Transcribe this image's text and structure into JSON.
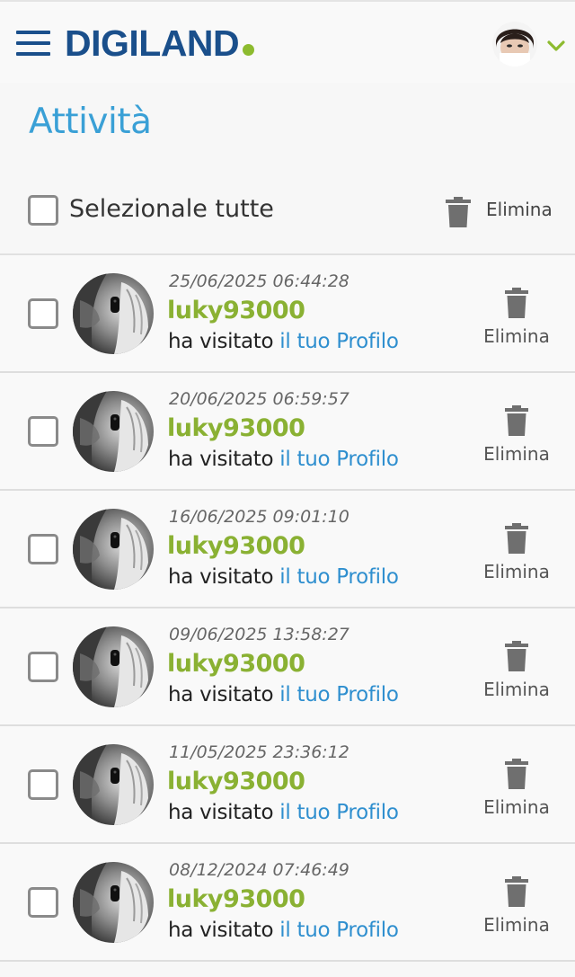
{
  "header": {
    "logo_text": "DIGILAND",
    "menu_icon": "hamburger-menu-icon",
    "account_icon": "chevron-down-icon",
    "brand_color": "#1a4f8b",
    "accent_color": "#8dbb2f"
  },
  "page": {
    "title": "Attività",
    "select_all_label": "Selezionale tutte",
    "delete_all_label": "Elimina"
  },
  "activities": [
    {
      "date": "25/06/2025 06:44:28",
      "user": "luky93000",
      "action": "ha visitato",
      "link": "il tuo Profilo",
      "delete": "Elimina"
    },
    {
      "date": "20/06/2025 06:59:57",
      "user": "luky93000",
      "action": "ha visitato",
      "link": "il tuo Profilo",
      "delete": "Elimina"
    },
    {
      "date": "16/06/2025 09:01:10",
      "user": "luky93000",
      "action": "ha visitato",
      "link": "il tuo Profilo",
      "delete": "Elimina"
    },
    {
      "date": "09/06/2025 13:58:27",
      "user": "luky93000",
      "action": "ha visitato",
      "link": "il tuo Profilo",
      "delete": "Elimina"
    },
    {
      "date": "11/05/2025 23:36:12",
      "user": "luky93000",
      "action": "ha visitato",
      "link": "il tuo Profilo",
      "delete": "Elimina"
    },
    {
      "date": "08/12/2024 07:46:49",
      "user": "luky93000",
      "action": "ha visitato",
      "link": "il tuo Profilo",
      "delete": "Elimina"
    }
  ]
}
